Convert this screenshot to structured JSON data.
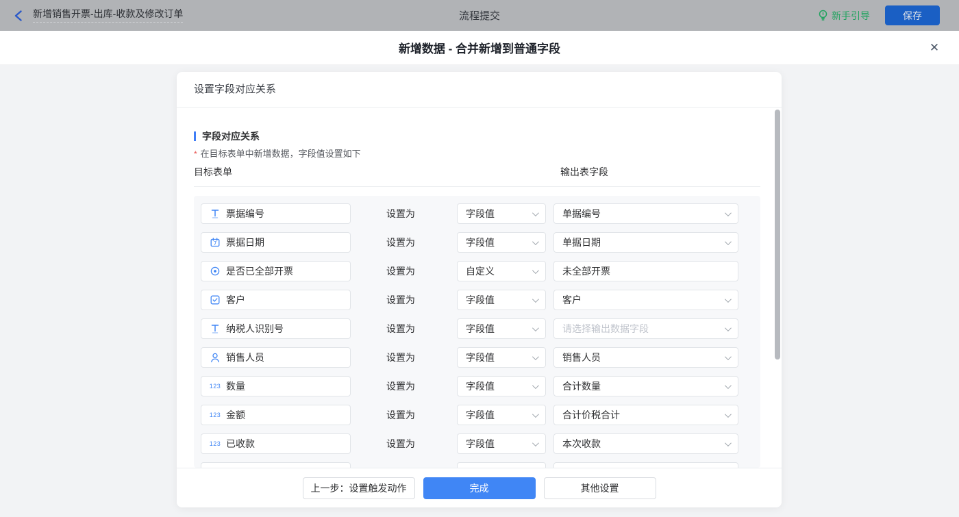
{
  "topbar": {
    "back_title": "新增销售开票-出库-收款及修改订单",
    "center_title": "流程提交",
    "guide_label": "新手引导",
    "save_label": "保存",
    "guide_color": "#21a35f",
    "save_color": "#1a5fc4"
  },
  "modal": {
    "title": "新增数据 - 合并新增到普通字段",
    "close_glyph": "✕"
  },
  "card": {
    "header": "设置字段对应关系",
    "section_title": "字段对应关系",
    "hint_mark": "*",
    "hint_text": "在目标表单中新增数据，字段值设置如下",
    "col_left": "目标表单",
    "col_right": "输出表字段",
    "set_as_label": "设置为",
    "rows": [
      {
        "icon": "text-field-icon",
        "field": "票据编号",
        "mode": "字段值",
        "value": "单据编号",
        "value_type": "select"
      },
      {
        "icon": "date-field-icon",
        "field": "票据日期",
        "mode": "字段值",
        "value": "单据日期",
        "value_type": "select"
      },
      {
        "icon": "radio-field-icon",
        "field": "是否已全部开票",
        "mode": "自定义",
        "value": "未全部开票",
        "value_type": "input"
      },
      {
        "icon": "select-field-icon",
        "field": "客户",
        "mode": "字段值",
        "value": "客户",
        "value_type": "select"
      },
      {
        "icon": "text-field-icon",
        "field": "纳税人识别号",
        "mode": "字段值",
        "value": "",
        "placeholder": "请选择输出数据字段",
        "value_type": "select"
      },
      {
        "icon": "user-field-icon",
        "field": "销售人员",
        "mode": "字段值",
        "value": "销售人员",
        "value_type": "select"
      },
      {
        "icon": "number-field-icon",
        "field": "数量",
        "mode": "字段值",
        "value": "合计数量",
        "value_type": "select"
      },
      {
        "icon": "number-field-icon",
        "field": "金额",
        "mode": "字段值",
        "value": "合计价税合计",
        "value_type": "select"
      },
      {
        "icon": "number-field-icon",
        "field": "已收款",
        "mode": "字段值",
        "value": "本次收款",
        "value_type": "select"
      },
      {
        "icon": "",
        "field": "",
        "mode": "",
        "value": "",
        "value_type": "partial"
      }
    ],
    "footer": {
      "prev_label": "上一步：设置触发动作",
      "done_label": "完成",
      "other_label": "其他设置"
    },
    "accent_color": "#4086f5"
  }
}
